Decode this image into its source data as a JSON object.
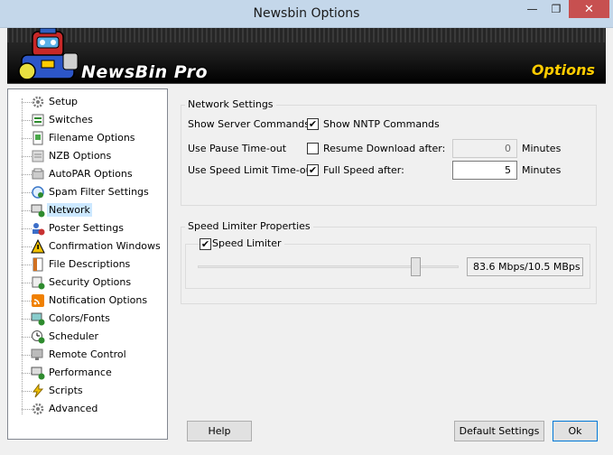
{
  "window": {
    "title": "Newsbin Options",
    "min_glyph": "—",
    "max_glyph": "❐",
    "close_glyph": "✕"
  },
  "banner": {
    "product": "NewsBin Pro",
    "section": "Options"
  },
  "tree": {
    "items": [
      {
        "label": "Setup",
        "icon": "gear-icon",
        "color": "#7a7a7a"
      },
      {
        "label": "Switches",
        "icon": "switches-icon",
        "color": "#2e8b2e"
      },
      {
        "label": "Filename Options",
        "icon": "filename-icon",
        "color": "#4aa84a"
      },
      {
        "label": "NZB Options",
        "icon": "nzb-icon",
        "color": "#8c8c8c"
      },
      {
        "label": "AutoPAR Options",
        "icon": "autopar-icon",
        "color": "#808080"
      },
      {
        "label": "Spam Filter Settings",
        "icon": "spam-filter-icon",
        "color": "#3c78c8"
      },
      {
        "label": "Network",
        "icon": "network-icon",
        "color": "#2e8b2e",
        "selected": true
      },
      {
        "label": "Poster Settings",
        "icon": "poster-icon",
        "color": "#c83232"
      },
      {
        "label": "Confirmation Windows",
        "icon": "warning-icon",
        "color": "#f0c000"
      },
      {
        "label": "File Descriptions",
        "icon": "file-description-icon",
        "color": "#d07020"
      },
      {
        "label": "Security Options",
        "icon": "security-icon",
        "color": "#2e8b2e"
      },
      {
        "label": "Notification Options",
        "icon": "rss-icon",
        "color": "#f08000"
      },
      {
        "label": "Colors/Fonts",
        "icon": "colors-icon",
        "color": "#2e8b2e"
      },
      {
        "label": "Scheduler",
        "icon": "scheduler-icon",
        "color": "#2e8b2e"
      },
      {
        "label": "Remote Control",
        "icon": "remote-control-icon",
        "color": "#7a7a7a"
      },
      {
        "label": "Performance",
        "icon": "performance-icon",
        "color": "#2e8b2e"
      },
      {
        "label": "Scripts",
        "icon": "lightning-icon",
        "color": "#f0c000"
      },
      {
        "label": "Advanced",
        "icon": "advanced-gear-icon",
        "color": "#7a7a7a"
      }
    ]
  },
  "network": {
    "title": "Network Settings",
    "rows": [
      {
        "label": "Show Server Commands:",
        "checked": true,
        "check_label": "Show NNTP Commands"
      },
      {
        "label": "Use Pause Time-out",
        "checked": false,
        "check_label": "Resume Download after:",
        "value": "0",
        "unit": "Minutes",
        "disabled": true
      },
      {
        "label": "Use Speed Limit Time-out:",
        "checked": true,
        "check_label": "Full Speed after:",
        "value": "5",
        "unit": "Minutes",
        "disabled": false
      }
    ]
  },
  "speed": {
    "title": "Speed Limiter Properties",
    "checkbox_label": "Speed Limiter",
    "checked": true,
    "value_text": "83.6 Mbps/10.5 MBps",
    "slider_fraction": 0.85
  },
  "buttons": {
    "help": "Help",
    "defaults": "Default Settings",
    "ok": "Ok"
  },
  "check_glyph": "✔"
}
